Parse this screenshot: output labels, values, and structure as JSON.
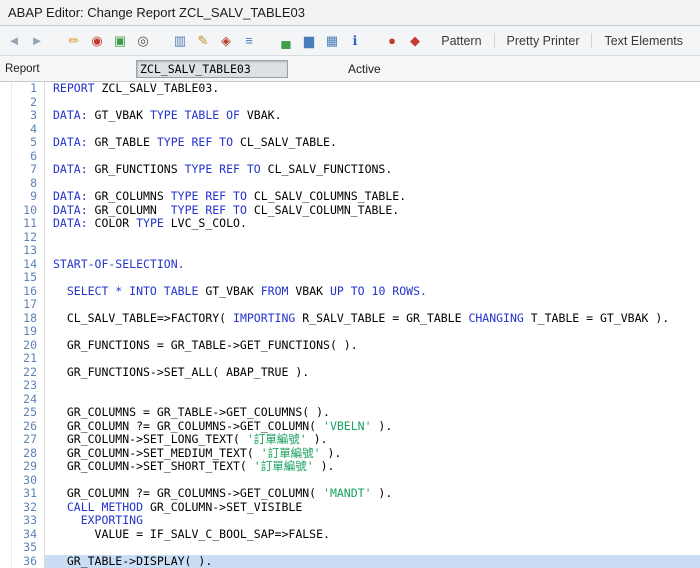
{
  "window": {
    "title": "ABAP Editor: Change Report ZCL_SALV_TABLE03"
  },
  "toolbar": {
    "icons": [
      {
        "name": "back-icon",
        "glyph": "◄",
        "color": "#95a3b2"
      },
      {
        "name": "forward-icon",
        "glyph": "►",
        "color": "#95a3b2"
      },
      {
        "type": "sep"
      },
      {
        "name": "display-change-icon",
        "glyph": "✏",
        "color": "#d99a1e"
      },
      {
        "name": "check-icon",
        "glyph": "◉",
        "color": "#c23b2e"
      },
      {
        "name": "activate-icon",
        "glyph": "▣",
        "color": "#3f9e4d"
      },
      {
        "name": "execute-icon",
        "glyph": "◎",
        "color": "#4a4a4a"
      },
      {
        "type": "sep"
      },
      {
        "name": "compare-icon",
        "glyph": "▥",
        "color": "#4a7ebb"
      },
      {
        "name": "pattern-wand-icon",
        "glyph": "✎",
        "color": "#c09020"
      },
      {
        "name": "where-used-icon",
        "glyph": "◈",
        "color": "#b3452e"
      },
      {
        "name": "hierarchy-icon",
        "glyph": "≡",
        "color": "#4a7ebb"
      },
      {
        "type": "sep"
      },
      {
        "name": "sort-asc-icon",
        "glyph": "▄",
        "color": "#3f9e4d"
      },
      {
        "name": "sort-desc-icon",
        "glyph": "▆",
        "color": "#4a7ebb"
      },
      {
        "name": "table-icon",
        "glyph": "▦",
        "color": "#4a7ebb"
      },
      {
        "name": "info-icon",
        "glyph": "ℹ",
        "color": "#2f5fd0"
      },
      {
        "type": "sep"
      },
      {
        "name": "breakpoint-icon",
        "glyph": "●",
        "color": "#c23b2e"
      },
      {
        "name": "stop-icon",
        "glyph": "◆",
        "color": "#c23b2e"
      }
    ],
    "text_buttons": [
      "Pattern",
      "Pretty Printer",
      "Text Elements"
    ]
  },
  "form": {
    "report_label": "Report",
    "report_value": "ZCL_SALV_TABLE03",
    "status": "Active"
  },
  "editor": {
    "active_line": 36,
    "lines": [
      {
        "n": 1,
        "t": [
          [
            "k",
            "REPORT "
          ],
          [
            "i",
            "ZCL_SALV_TABLE03."
          ]
        ]
      },
      {
        "n": 2,
        "t": []
      },
      {
        "n": 3,
        "t": [
          [
            "k",
            "DATA:"
          ],
          [
            "i",
            " GT_VBAK "
          ],
          [
            "k",
            "TYPE TABLE OF "
          ],
          [
            "i",
            "VBAK."
          ]
        ]
      },
      {
        "n": 4,
        "t": []
      },
      {
        "n": 5,
        "t": [
          [
            "k",
            "DATA:"
          ],
          [
            "i",
            " GR_TABLE "
          ],
          [
            "k",
            "TYPE REF TO "
          ],
          [
            "i",
            "CL_SALV_TABLE."
          ]
        ]
      },
      {
        "n": 6,
        "t": []
      },
      {
        "n": 7,
        "t": [
          [
            "k",
            "DATA:"
          ],
          [
            "i",
            " GR_FUNCTIONS "
          ],
          [
            "k",
            "TYPE REF TO "
          ],
          [
            "i",
            "CL_SALV_FUNCTIONS."
          ]
        ]
      },
      {
        "n": 8,
        "t": []
      },
      {
        "n": 9,
        "t": [
          [
            "k",
            "DATA:"
          ],
          [
            "i",
            " GR_COLUMNS "
          ],
          [
            "k",
            "TYPE REF TO "
          ],
          [
            "i",
            "CL_SALV_COLUMNS_TABLE."
          ]
        ]
      },
      {
        "n": 10,
        "t": [
          [
            "k",
            "DATA:"
          ],
          [
            "i",
            " GR_COLUMN  "
          ],
          [
            "k",
            "TYPE REF TO "
          ],
          [
            "i",
            "CL_SALV_COLUMN_TABLE."
          ]
        ]
      },
      {
        "n": 11,
        "t": [
          [
            "k",
            "DATA:"
          ],
          [
            "i",
            " COLOR "
          ],
          [
            "k",
            "TYPE "
          ],
          [
            "i",
            "LVC_S_COLO."
          ]
        ]
      },
      {
        "n": 12,
        "t": []
      },
      {
        "n": 13,
        "t": []
      },
      {
        "n": 14,
        "t": [
          [
            "k",
            "START-OF-SELECTION."
          ]
        ]
      },
      {
        "n": 15,
        "t": []
      },
      {
        "n": 16,
        "t": [
          [
            "k",
            "  SELECT * INTO TABLE "
          ],
          [
            "i",
            "GT_VBAK "
          ],
          [
            "k",
            "FROM "
          ],
          [
            "i",
            "VBAK "
          ],
          [
            "k",
            "UP TO "
          ],
          [
            "n2",
            "10"
          ],
          [
            "k",
            " ROWS."
          ]
        ]
      },
      {
        "n": 17,
        "t": []
      },
      {
        "n": 18,
        "t": [
          [
            "i",
            "  CL_SALV_TABLE=>FACTORY( "
          ],
          [
            "k",
            "IMPORTING "
          ],
          [
            "i",
            "R_SALV_TABLE = GR_TABLE "
          ],
          [
            "k",
            "CHANGING "
          ],
          [
            "i",
            "T_TABLE = GT_VBAK )."
          ]
        ]
      },
      {
        "n": 19,
        "t": []
      },
      {
        "n": 20,
        "t": [
          [
            "i",
            "  GR_FUNCTIONS = GR_TABLE->GET_FUNCTIONS( )."
          ]
        ]
      },
      {
        "n": 21,
        "t": []
      },
      {
        "n": 22,
        "t": [
          [
            "i",
            "  GR_FUNCTIONS->SET_ALL( ABAP_TRUE )."
          ]
        ]
      },
      {
        "n": 23,
        "t": []
      },
      {
        "n": 24,
        "t": []
      },
      {
        "n": 25,
        "t": [
          [
            "i",
            "  GR_COLUMNS = GR_TABLE->GET_COLUMNS( )."
          ]
        ]
      },
      {
        "n": 26,
        "t": [
          [
            "i",
            "  GR_COLUMN ?= GR_COLUMNS->GET_COLUMN( "
          ],
          [
            "s",
            "'VBELN'"
          ],
          [
            "i",
            " )."
          ]
        ]
      },
      {
        "n": 27,
        "t": [
          [
            "i",
            "  GR_COLUMN->SET_LONG_TEXT( "
          ],
          [
            "s",
            "'訂單編號'"
          ],
          [
            "i",
            " )."
          ]
        ]
      },
      {
        "n": 28,
        "t": [
          [
            "i",
            "  GR_COLUMN->SET_MEDIUM_TEXT( "
          ],
          [
            "s",
            "'訂單編號'"
          ],
          [
            "i",
            " )."
          ]
        ]
      },
      {
        "n": 29,
        "t": [
          [
            "i",
            "  GR_COLUMN->SET_SHORT_TEXT( "
          ],
          [
            "s",
            "'訂單編號'"
          ],
          [
            "i",
            " )."
          ]
        ]
      },
      {
        "n": 30,
        "t": []
      },
      {
        "n": 31,
        "t": [
          [
            "i",
            "  GR_COLUMN ?= GR_COLUMNS->GET_COLUMN( "
          ],
          [
            "s",
            "'MANDT'"
          ],
          [
            "i",
            " )."
          ]
        ]
      },
      {
        "n": 32,
        "t": [
          [
            "k",
            "  CALL METHOD "
          ],
          [
            "i",
            "GR_COLUMN->SET_VISIBLE"
          ]
        ]
      },
      {
        "n": 33,
        "t": [
          [
            "k",
            "    EXPORTING"
          ]
        ]
      },
      {
        "n": 34,
        "t": [
          [
            "i",
            "      VALUE = IF_SALV_C_BOOL_SAP=>FALSE."
          ]
        ]
      },
      {
        "n": 35,
        "t": []
      },
      {
        "n": 36,
        "t": [
          [
            "i",
            "  GR_TABLE->DISPLAY( )."
          ]
        ]
      }
    ]
  },
  "colors": {
    "keyword": "#2333cc",
    "identifier": "#000000",
    "string": "#17a05e",
    "number": "#2333cc",
    "line-number": "#5f83b5",
    "active-line": "#c9def4",
    "accent-blue": "#4a7ebb"
  }
}
